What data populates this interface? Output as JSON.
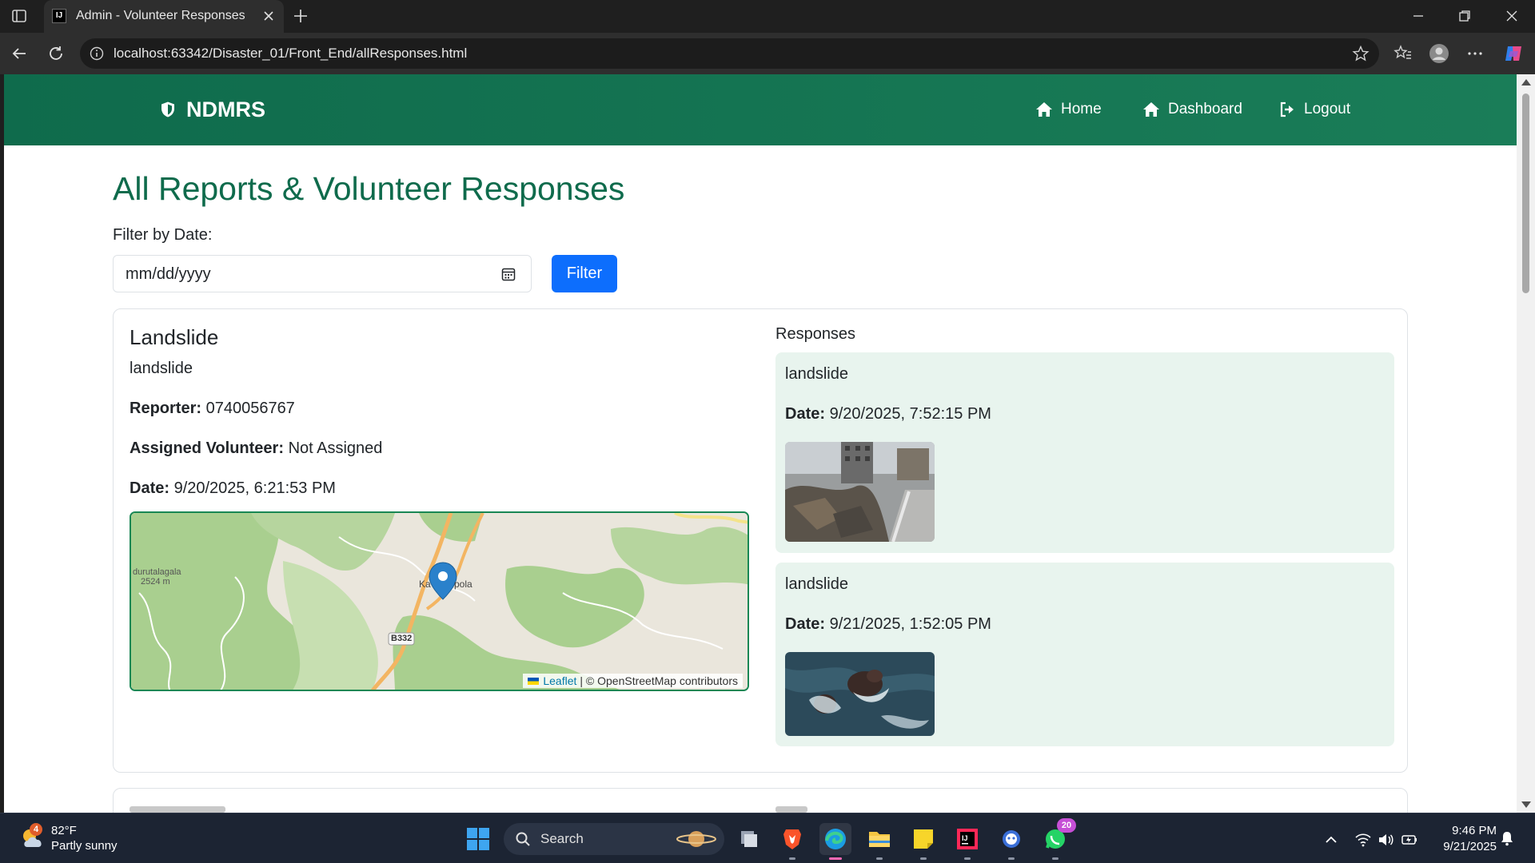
{
  "browser": {
    "tab_title": "Admin - Volunteer Responses",
    "url": "localhost:63342/Disaster_01/Front_End/allResponses.html"
  },
  "navbar": {
    "brand": "NDMRS",
    "links": [
      {
        "label": "Home",
        "icon": "home-icon"
      },
      {
        "label": "Dashboard",
        "icon": "home-icon"
      },
      {
        "label": "Logout",
        "icon": "logout-icon"
      }
    ]
  },
  "page": {
    "title": "All Reports & Volunteer Responses",
    "filter_label": "Filter by Date:",
    "date_placeholder": "mm/dd/yyyy",
    "filter_button": "Filter"
  },
  "reports": [
    {
      "title": "Landslide",
      "description": "landslide",
      "reporter_label": "Reporter:",
      "reporter": "0740056767",
      "volunteer_label": "Assigned Volunteer:",
      "volunteer": "Not Assigned",
      "date_label": "Date:",
      "date": "9/20/2025, 6:21:53 PM",
      "map": {
        "labels": [
          "durutalagala",
          "2524 m",
          "Ka",
          "pola",
          "B332"
        ],
        "attribution_link": "Leaflet",
        "attribution_text": "| © OpenStreetMap contributors"
      },
      "responses_heading": "Responses",
      "responses": [
        {
          "text": "landslide",
          "date_label": "Date:",
          "date": "9/20/2025, 7:52:15 PM",
          "image": "collapsed-building-photo"
        },
        {
          "text": "landslide",
          "date_label": "Date:",
          "date": "9/21/2025, 1:52:05 PM",
          "image": "rocks-in-sea-photo"
        }
      ]
    }
  ],
  "taskbar": {
    "weather_temp": "82°F",
    "weather_desc": "Partly sunny",
    "weather_badge": "4",
    "search_label": "Search",
    "whatsapp_badge": "20",
    "time": "9:46 PM",
    "date": "9/21/2025"
  },
  "colors": {
    "brand_green": "#0f6b4c",
    "filter_blue": "#0d6efd",
    "response_bg": "#e8f4ee",
    "map_border": "#198754"
  }
}
